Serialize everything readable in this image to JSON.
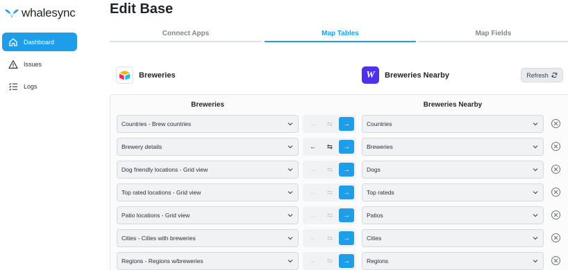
{
  "brand": {
    "name": "whalesync",
    "accent": "#1e9ee8"
  },
  "sidebar": {
    "items": [
      {
        "label": "Dashboard",
        "icon": "home-icon",
        "active": true
      },
      {
        "label": "Issues",
        "icon": "warning-icon",
        "active": false
      },
      {
        "label": "Logs",
        "icon": "list-check-icon",
        "active": false
      }
    ]
  },
  "page": {
    "title": "Edit Base"
  },
  "tabs": [
    {
      "label": "Connect Apps",
      "active": false
    },
    {
      "label": "Map Tables",
      "active": true
    },
    {
      "label": "Map Fields",
      "active": false
    }
  ],
  "left_app": {
    "name": "Breweries",
    "icon": "airtable-logo-icon"
  },
  "right_app": {
    "name": "Breweries Nearby",
    "icon": "webflow-logo-icon",
    "logo_letter": "W"
  },
  "refresh_label": "Refresh",
  "columns": {
    "left": "Breweries",
    "right": "Breweries Nearby"
  },
  "mappings": [
    {
      "left": "Countries - Brew countries",
      "right": "Countries",
      "two_way": false
    },
    {
      "left": "Brewery details",
      "right": "Breweries",
      "two_way": true
    },
    {
      "left": "Dog friendly locations - Grid view",
      "right": "Dogs",
      "two_way": false
    },
    {
      "left": "Top rated locations - Grid view",
      "right": "Top rateds",
      "two_way": false
    },
    {
      "left": "Patio locations - Grid view",
      "right": "Patios",
      "two_way": false
    },
    {
      "left": "Cities - Cities with breweries",
      "right": "Cities",
      "two_way": false
    },
    {
      "left": "Regions - Regions w/breweries",
      "right": "Regions",
      "two_way": false
    }
  ]
}
